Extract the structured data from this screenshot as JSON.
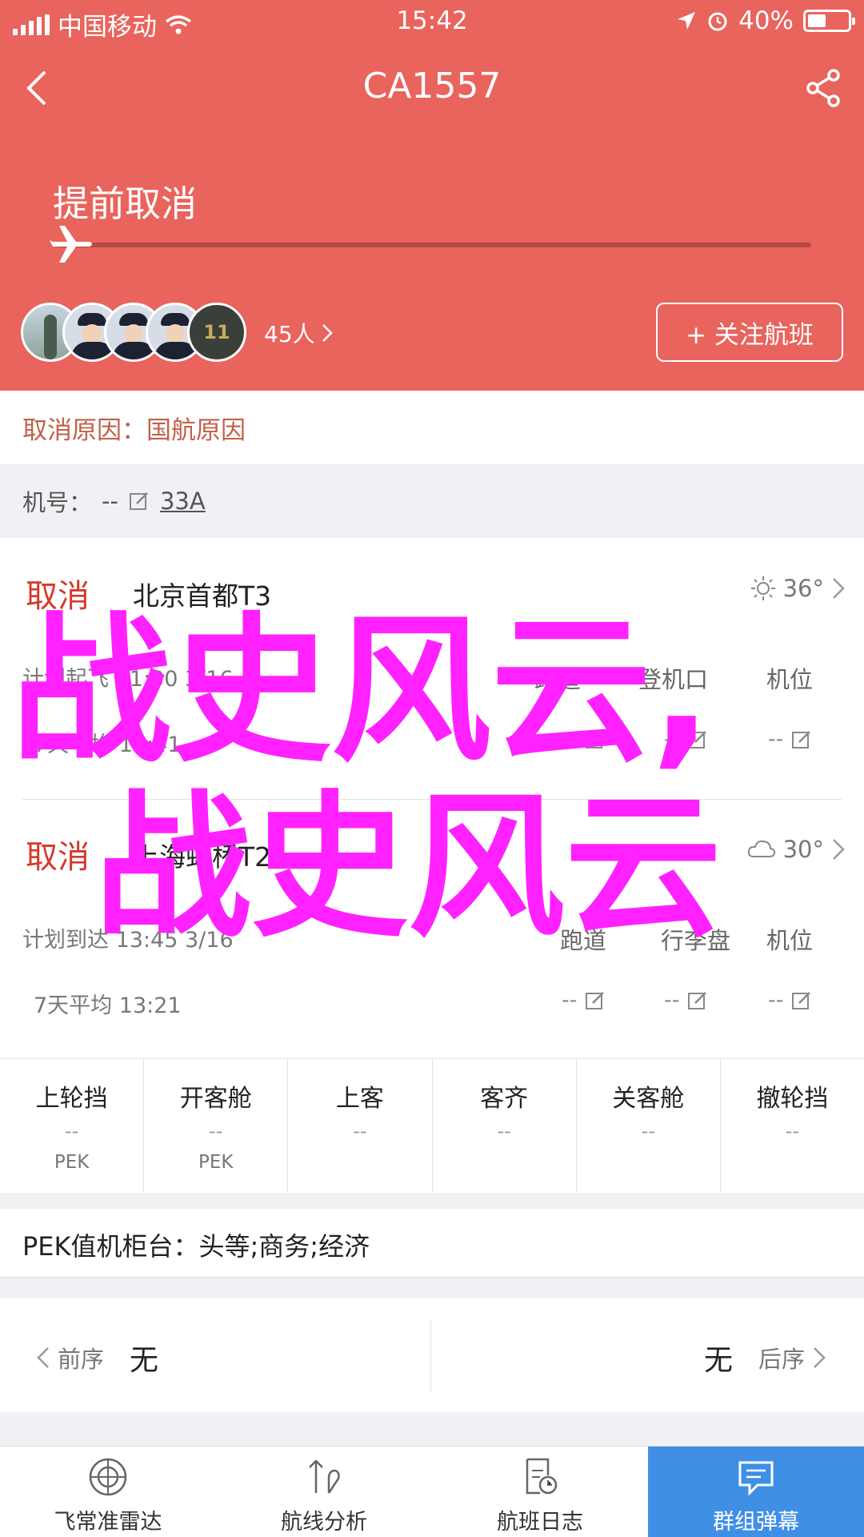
{
  "status_bar": {
    "carrier": "中国移动",
    "time": "15:42",
    "battery": "40%",
    "battery_level": 0.4
  },
  "nav": {
    "title": "CA1557"
  },
  "flight_status": {
    "label": "提前取消",
    "progress": 0
  },
  "followers": {
    "count_label": "45人",
    "follow_button": "+ 关注航班",
    "avatar_jersey_number": "11"
  },
  "cancel_reason": {
    "label": "取消原因：",
    "value": "国航原因"
  },
  "aircraft": {
    "label": "机号：",
    "value": "--",
    "link": "33A"
  },
  "segments": [
    {
      "status": "取消",
      "airport": "北京首都T3",
      "weather_temp": "36°",
      "weather_icon": "sun-icon",
      "plan_label": "计划起飞",
      "plan_value": "11:30 3/16",
      "avg_label": "7天平均",
      "avg_value": "11:41",
      "columns": [
        "跑道",
        "登机口",
        "机位"
      ],
      "values": [
        "--",
        "--",
        "--"
      ]
    },
    {
      "status": "取消",
      "airport": "上海虹桥T2",
      "weather_temp": "30°",
      "weather_icon": "cloud-icon",
      "plan_label": "计划到达",
      "plan_value": "13:45 3/16",
      "avg_label": "7天平均",
      "avg_value": "13:21",
      "columns": [
        "跑道",
        "行李盘",
        "机位"
      ],
      "values": [
        "--",
        "--",
        "--"
      ]
    }
  ],
  "overlay_text": {
    "line1": "战史风云,",
    "line2": "战史风云"
  },
  "boarding_steps": [
    {
      "name": "上轮挡",
      "value": "--",
      "code": "PEK"
    },
    {
      "name": "开客舱",
      "value": "--",
      "code": "PEK"
    },
    {
      "name": "上客",
      "value": "--",
      "code": ""
    },
    {
      "name": "客齐",
      "value": "--",
      "code": ""
    },
    {
      "name": "关客舱",
      "value": "--",
      "code": ""
    },
    {
      "name": "撤轮挡",
      "value": "--",
      "code": ""
    }
  ],
  "checkin_counter": {
    "label": "PEK值机柜台：",
    "value": "头等;商务;经济"
  },
  "prev_next": {
    "prev_label": "前序",
    "prev_value": "无",
    "next_label": "后序",
    "next_value": "无"
  },
  "tabs": [
    {
      "label": "飞常准雷达",
      "icon": "radar-icon",
      "active": false
    },
    {
      "label": "航线分析",
      "icon": "route-icon",
      "active": false
    },
    {
      "label": "航班日志",
      "icon": "log-icon",
      "active": false
    },
    {
      "label": "群组弹幕",
      "icon": "chat-icon",
      "active": true
    }
  ],
  "colors": {
    "header": "#e8645d",
    "cancel": "#d33a2c",
    "reason": "#c2604a",
    "overlay": "#ff21ff",
    "active_tab": "#3f8fe5"
  }
}
